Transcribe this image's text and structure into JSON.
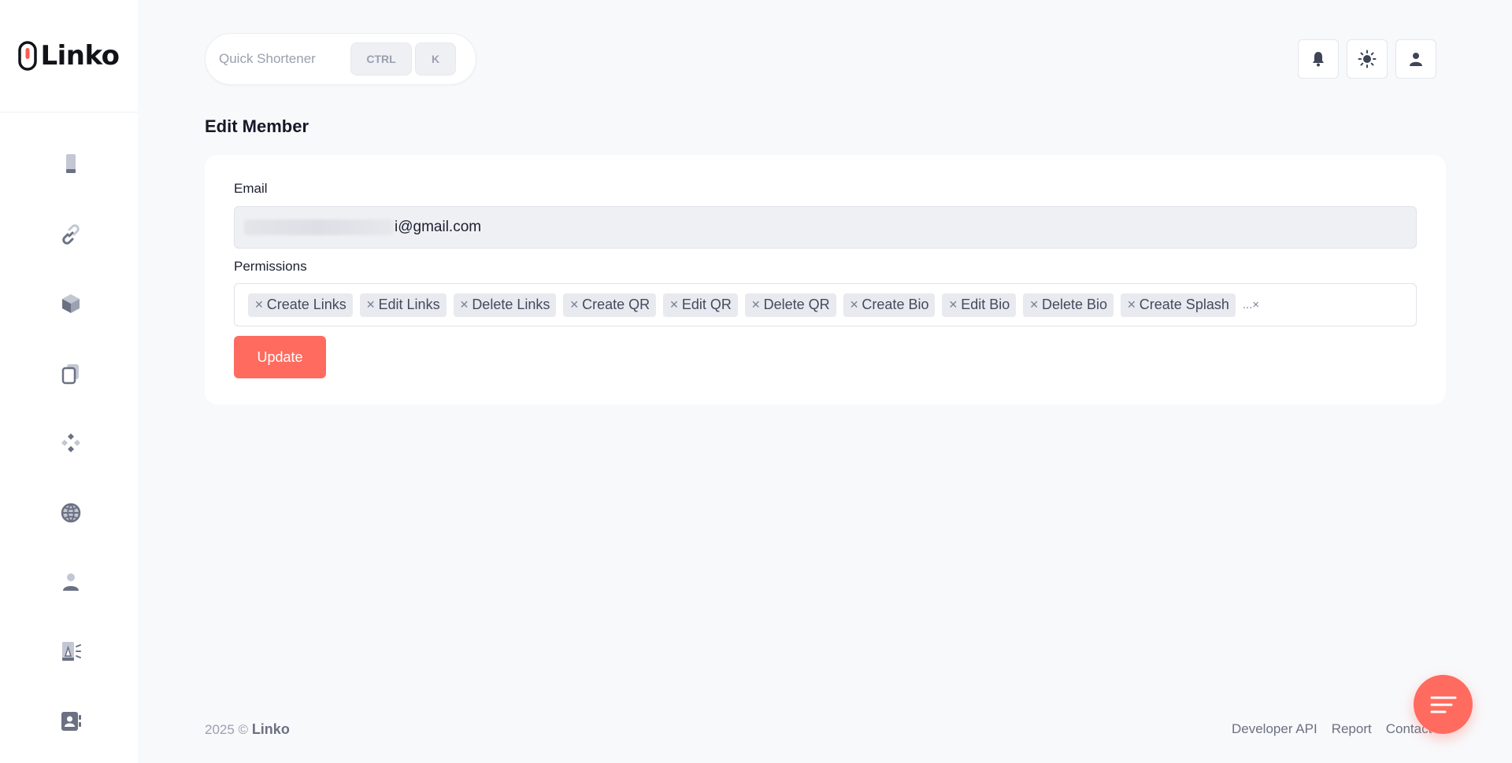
{
  "app": {
    "name": "Linko"
  },
  "header": {
    "quick_shortener_label": "Quick Shortener",
    "shortcut_keys": [
      "CTRL",
      "K"
    ]
  },
  "page": {
    "title": "Edit Member"
  },
  "form": {
    "email_label": "Email",
    "email_value_visible": "i@gmail.com",
    "permissions_label": "Permissions",
    "permissions": [
      "Create Links",
      "Edit Links",
      "Delete Links",
      "Create QR",
      "Edit QR",
      "Delete QR",
      "Create Bio",
      "Edit Bio",
      "Delete Bio",
      "Create Splash"
    ],
    "permissions_overflow": "...×",
    "update_label": "Update"
  },
  "footer": {
    "copyright": "2025 ©",
    "brand": "Linko",
    "links": [
      "Developer API",
      "Report",
      "Contact"
    ]
  },
  "colors": {
    "accent": "#ff6b5e",
    "background": "#f8f9fb",
    "icon": "#6b7183"
  },
  "sidebar": {
    "icons": [
      "phone-icon",
      "link-icon",
      "cube-icon",
      "copy-icon",
      "apps-icon",
      "globe-icon",
      "user-icon",
      "campaign-icon",
      "contacts-icon"
    ]
  }
}
